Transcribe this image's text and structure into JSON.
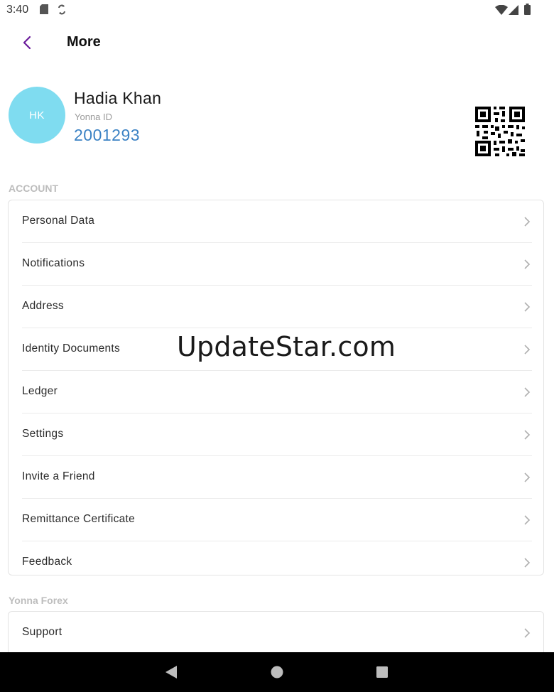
{
  "status_bar": {
    "time": "3:40"
  },
  "header": {
    "title": "More"
  },
  "profile": {
    "initials": "HK",
    "name": "Hadia Khan",
    "id_label": "Yonna ID",
    "id_value": "2001293"
  },
  "account_section": {
    "label": "ACCOUNT",
    "items": [
      {
        "label": "Personal Data"
      },
      {
        "label": "Notifications"
      },
      {
        "label": "Address"
      },
      {
        "label": "Identity Documents"
      },
      {
        "label": "Ledger"
      },
      {
        "label": "Settings"
      },
      {
        "label": "Invite a Friend"
      },
      {
        "label": "Remittance Certificate"
      },
      {
        "label": "Feedback"
      }
    ]
  },
  "forex_section": {
    "label": "Yonna Forex",
    "items": [
      {
        "label": "Support"
      }
    ]
  },
  "watermark": "UpdateStar.com",
  "colors": {
    "avatar": "#7fdcf0",
    "id_value": "#3b82c4",
    "back_icon": "#6a1b9a"
  }
}
